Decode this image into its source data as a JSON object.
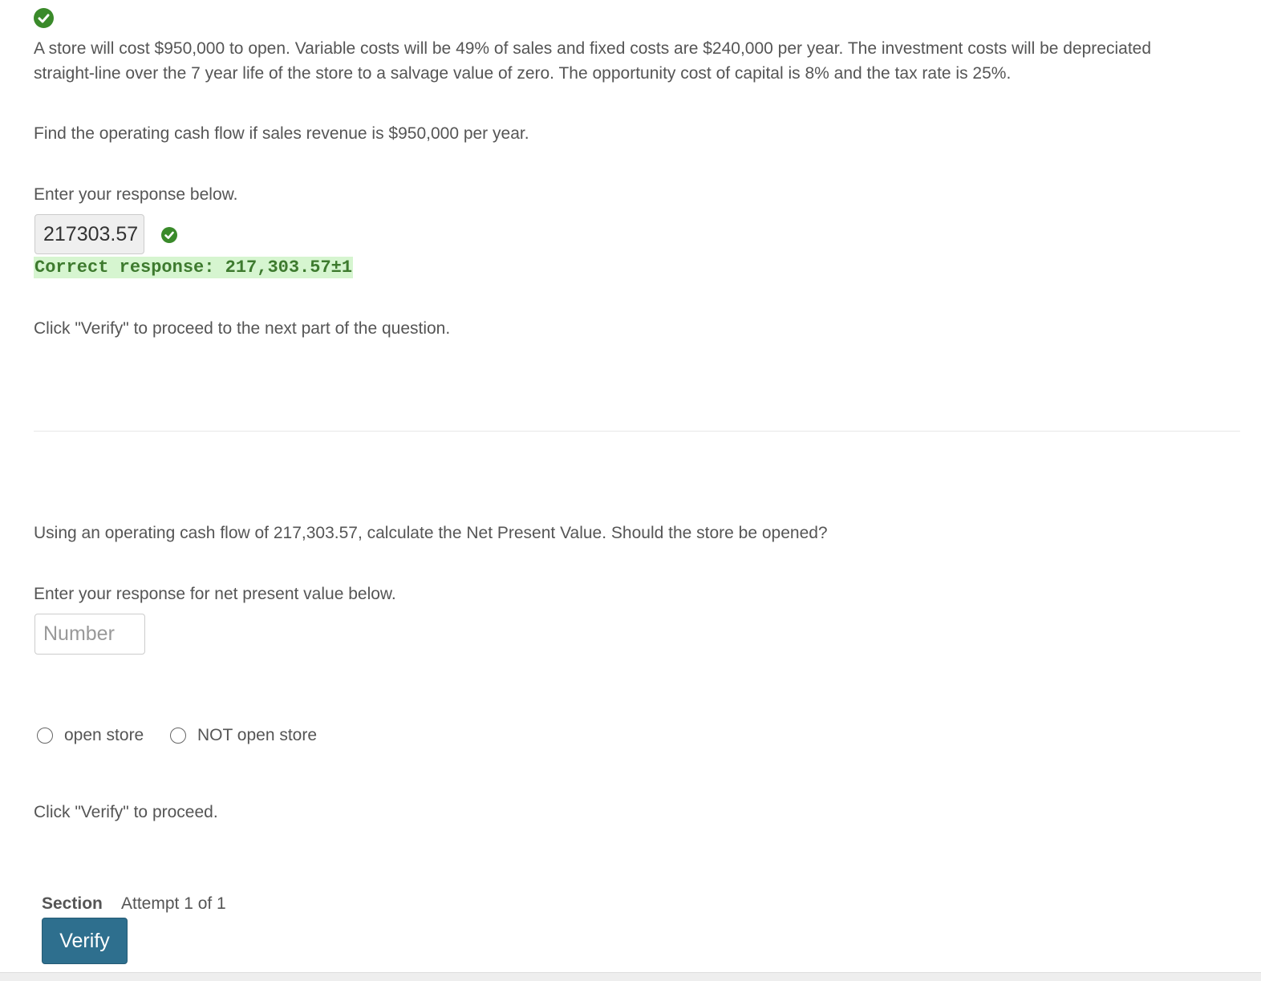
{
  "problem": {
    "text": "A store will cost $950,000 to open. Variable costs will be 49% of sales and fixed costs are $240,000 per year. The investment costs will be depreciated straight-line over the 7 year life of the store to a salvage value of zero. The opportunity cost of capital is 8% and the tax rate is 25%."
  },
  "part1": {
    "question": "Find the operating cash flow if sales revenue is $950,000 per year.",
    "prompt": "Enter your response below.",
    "input_value": "217303.57",
    "correct_response": "Correct response: 217,303.57±1",
    "verify_hint": "Click \"Verify\" to proceed to the next part of the question."
  },
  "part2": {
    "question": "Using an operating cash flow of 217,303.57, calculate the Net Present Value. Should the store be opened?",
    "prompt": "Enter your response for net present value below.",
    "input_placeholder": "Number",
    "input_value": "",
    "options": [
      {
        "label": "open store",
        "selected": false
      },
      {
        "label": "NOT open store",
        "selected": false
      }
    ],
    "verify_hint": "Click \"Verify\" to proceed."
  },
  "footer": {
    "section_label": "Section",
    "attempt_text": "Attempt 1 of 1",
    "verify_label": "Verify"
  },
  "colors": {
    "correct_green": "#3a8a2a",
    "correct_bg": "#d6f5d0",
    "button_blue": "#2e6f8e"
  },
  "icons": {
    "status": "check-circle-icon"
  }
}
